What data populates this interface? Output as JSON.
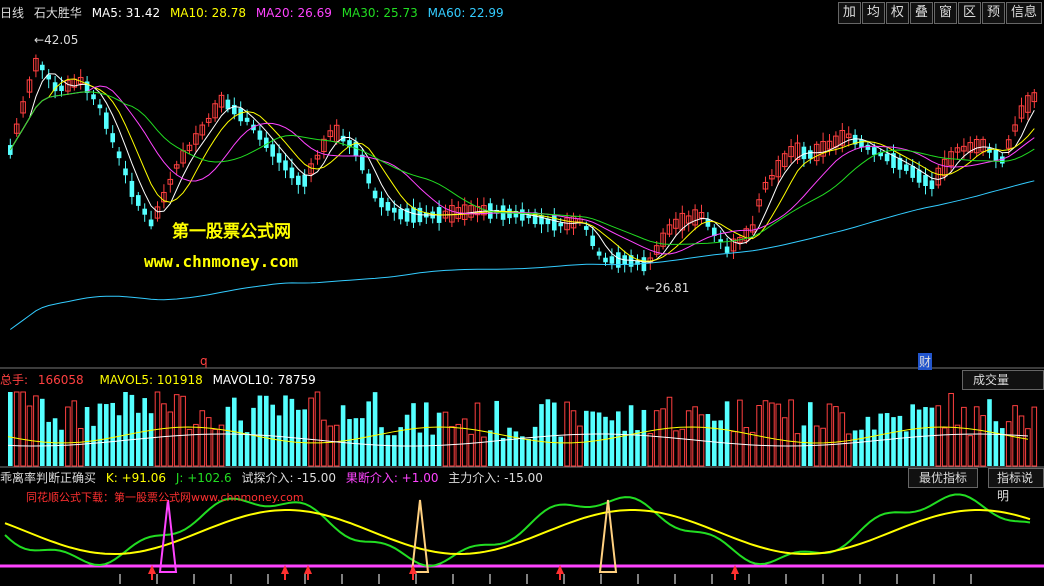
{
  "header": {
    "period": "日线",
    "stock_name": "石大胜华",
    "ma": [
      {
        "label": "MA5: 31.42",
        "color": "#ffffff"
      },
      {
        "label": "MA10: 28.78",
        "color": "#ffff00"
      },
      {
        "label": "MA20: 26.69",
        "color": "#ff44ff"
      },
      {
        "label": "MA30: 25.73",
        "color": "#22dd22"
      },
      {
        "label": "MA60: 22.99",
        "color": "#33ccff"
      }
    ]
  },
  "toolbar": {
    "buttons": [
      "加",
      "均",
      "权",
      "叠",
      "窗",
      "区",
      "预",
      "信息"
    ]
  },
  "main_chart": {
    "watermark_cn": "第一股票公式网",
    "watermark_url": "www.chnmoney.com",
    "high_label": "42.05",
    "low_label": "26.81",
    "flag_q": "q",
    "flag_cai": "财",
    "colors": {
      "up": "#ff4040",
      "down": "#55ffff"
    }
  },
  "volume": {
    "total_label": "总手: ",
    "total_value": "166058",
    "mavol5": "MAVOL5: 101918",
    "mavol10": "MAVOL10: 78759",
    "button": "成交量"
  },
  "indicator": {
    "name": "乖离率判断正确买",
    "k": "K: +91.06",
    "j": "J: +102.6",
    "try_entry": "试探介入: -15.00",
    "decisive_entry": "果断介入: +1.00",
    "main_entry": "主力介入: -15.00",
    "note": "同花顺公式下载：第一股票公式网www.chnmoney.com",
    "buttons": [
      "最优指标",
      "指标说明"
    ]
  }
}
